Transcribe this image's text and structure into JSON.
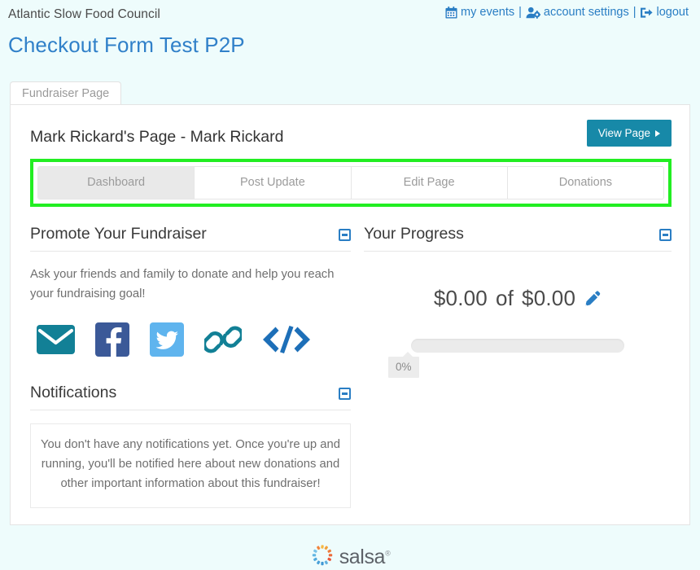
{
  "header": {
    "org_name": "Atlantic Slow Food Council",
    "page_title": "Checkout Form Test P2P",
    "links": [
      {
        "label": "my events",
        "icon": "calendar-icon"
      },
      {
        "label": "account settings",
        "icon": "user-gear-icon"
      },
      {
        "label": "logout",
        "icon": "sign-out-icon"
      }
    ],
    "separator": "|",
    "link_color": "#2a7ec4",
    "title_color": "#3080c9"
  },
  "page_tab": {
    "label": "Fundraiser Page"
  },
  "card": {
    "fundraiser_heading": "Mark Rickard's Page - Mark Rickard",
    "view_page_label": "View Page",
    "view_page_color": "#1789a8"
  },
  "nav": {
    "highlight_color": "#22ee22",
    "tabs": [
      {
        "label": "Dashboard",
        "active": true
      },
      {
        "label": "Post Update",
        "active": false
      },
      {
        "label": "Edit Page",
        "active": false
      },
      {
        "label": "Donations",
        "active": false
      }
    ]
  },
  "promote": {
    "title": "Promote Your Fundraiser",
    "body": "Ask your friends and family to donate and help you reach your fundraising goal!",
    "share_icons": [
      {
        "name": "email-icon",
        "color": "#128096"
      },
      {
        "name": "facebook-icon",
        "color": "#3b5998"
      },
      {
        "name": "twitter-icon",
        "color": "#5fb4ee"
      },
      {
        "name": "copy-link-icon",
        "color": "#128096"
      },
      {
        "name": "embed-code-icon",
        "color": "#1d6fb8"
      }
    ]
  },
  "notifications": {
    "title": "Notifications",
    "empty_message": "You don't have any notifications yet. Once you're up and running, you'll be notified here about new donations and other important information about this fundraiser!"
  },
  "progress": {
    "title": "Your Progress",
    "raised": "$0.00",
    "of_word": "of",
    "goal": "$0.00",
    "percent_label": "0%",
    "percent_value": 0,
    "edit_icon": "pencil-icon",
    "edit_icon_color": "#2a7ec4"
  },
  "footer": {
    "brand": "salsa",
    "trademark": "®"
  }
}
